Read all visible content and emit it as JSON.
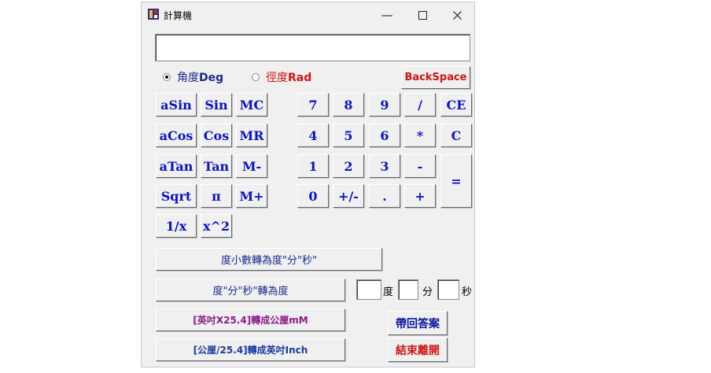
{
  "window": {
    "title": "計算機"
  },
  "display": {
    "value": ""
  },
  "mode": {
    "deg_label_cn": "角度",
    "deg_label_en": "Deg",
    "rad_label_cn": "徑度",
    "rad_label_en": "Rad",
    "selected": "deg"
  },
  "buttons": {
    "backspace": "BackSpace",
    "asin": "aSin",
    "sin": "Sin",
    "mc": "MC",
    "acos": "aCos",
    "cos": "Cos",
    "mr": "MR",
    "atan": "aTan",
    "tan": "Tan",
    "mminus": "M-",
    "sqrt": "Sqrt",
    "pi": "π",
    "mplus": "M+",
    "recip": "1/x",
    "square": "x^2",
    "d7": "7",
    "d8": "8",
    "d9": "9",
    "div": "/",
    "ce": "CE",
    "d4": "4",
    "d5": "5",
    "d6": "6",
    "mul": "*",
    "clear": "C",
    "d1": "1",
    "d2": "2",
    "d3": "3",
    "sub": "-",
    "eq": "=",
    "d0": "0",
    "sign": "+/-",
    "dot": ".",
    "add": "+",
    "dec_to_dms": "度小數轉為度\"分\"秒\"",
    "dms_to_dec": "度\"分\"秒\"轉為度",
    "in_to_mm": "[英吋X25.4]轉成公厘mM",
    "mm_to_in": "[公厘/25.4]轉成英吋Inch",
    "return_answer": "帶回答案",
    "exit": "結束離開"
  },
  "dms": {
    "deg_unit": "度",
    "min_unit": "分",
    "sec_unit": "秒",
    "deg_value": "",
    "min_value": "",
    "sec_value": ""
  },
  "colors": {
    "digit": "#0a12c8",
    "red": "#d01414",
    "purple": "#8a1a8a"
  }
}
